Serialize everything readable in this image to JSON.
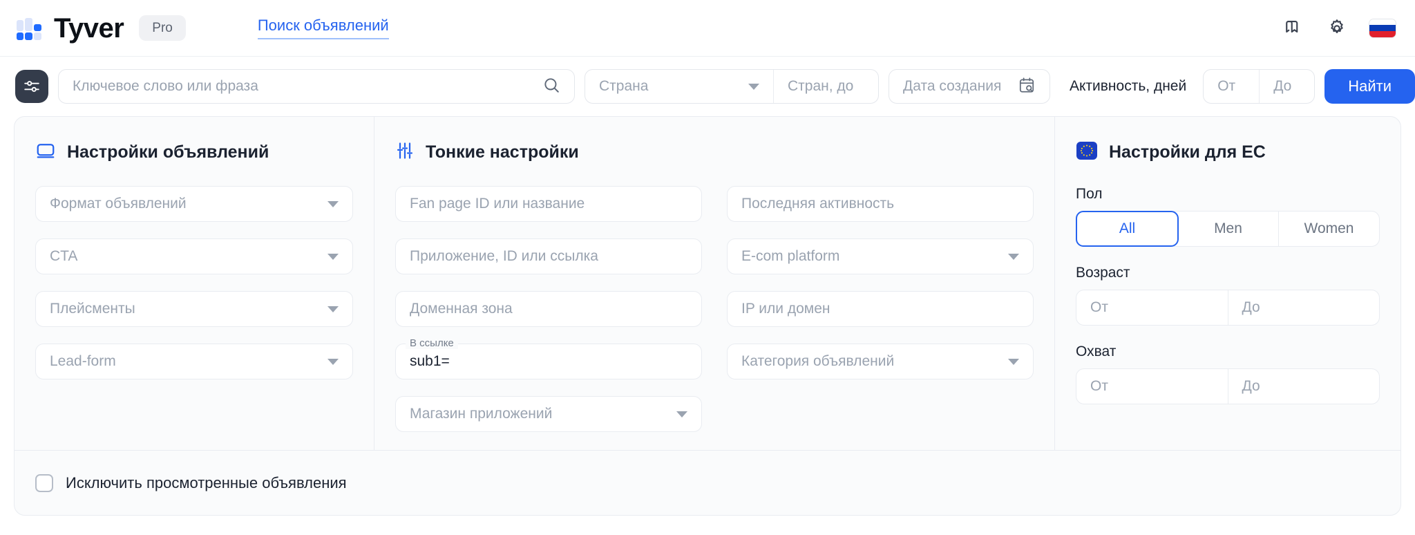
{
  "header": {
    "brand_name": "Tyver",
    "pro_badge": "Pro",
    "nav_link": "Поиск объявлений",
    "icons": {
      "bookmark": "bookmark-icon",
      "gear": "gear-icon",
      "flag": "russia-flag-icon"
    }
  },
  "search": {
    "filter_icon": "filter-sliders-icon",
    "keyword_placeholder": "Ключевое слово или фраза",
    "keyword_value": "",
    "search_icon": "search-icon",
    "country_placeholder": "Страна",
    "country_to_placeholder": "Стран, до",
    "date_placeholder": "Дата создания",
    "date_icon": "calendar-search-icon",
    "activity_label": "Активность, дней",
    "activity_from": "От",
    "activity_to": "До",
    "find_button": "Найти",
    "clear_button": "×"
  },
  "ads_settings": {
    "icon": "display-monitor-icon",
    "title": "Настройки объявлений",
    "fields": [
      {
        "placeholder": "Формат объявлений"
      },
      {
        "placeholder": "CTA"
      },
      {
        "placeholder": "Плейсменты"
      },
      {
        "placeholder": "Lead-form"
      }
    ]
  },
  "fine_settings": {
    "icon": "equalizer-sliders-icon",
    "title": "Тонкие настройки",
    "left_fields": [
      {
        "type": "input",
        "placeholder": "Fan page ID или название"
      },
      {
        "type": "input",
        "placeholder": "Приложение, ID или ссылка"
      },
      {
        "type": "input",
        "placeholder": "Доменная зона"
      },
      {
        "type": "float",
        "label": "В ссылке",
        "value": "sub1="
      },
      {
        "type": "select",
        "placeholder": "Магазин приложений"
      }
    ],
    "right_fields": [
      {
        "type": "input",
        "placeholder": "Последняя активность"
      },
      {
        "type": "select",
        "placeholder": "E-com platform"
      },
      {
        "type": "input",
        "placeholder": "IP или домен"
      },
      {
        "type": "select",
        "placeholder": "Категория объявлений"
      }
    ]
  },
  "eu_settings": {
    "icon": "eu-flag-icon",
    "title": "Настройки для ЕС",
    "gender_label": "Пол",
    "gender_options": [
      "All",
      "Men",
      "Women"
    ],
    "gender_selected": "All",
    "age_label": "Возраст",
    "age_from": "От",
    "age_to": "До",
    "reach_label": "Охват",
    "reach_from": "От",
    "reach_to": "До"
  },
  "footer": {
    "checkbox_checked": false,
    "checkbox_label": "Исключить просмотренные объявления"
  },
  "colors": {
    "accent": "#2563ef",
    "logo_light": "#dbe4fb",
    "logo_dark": "#1f6bff",
    "text": "#1b2230",
    "muted": "#9aa3b0",
    "filter_btn": "#343c4b"
  }
}
